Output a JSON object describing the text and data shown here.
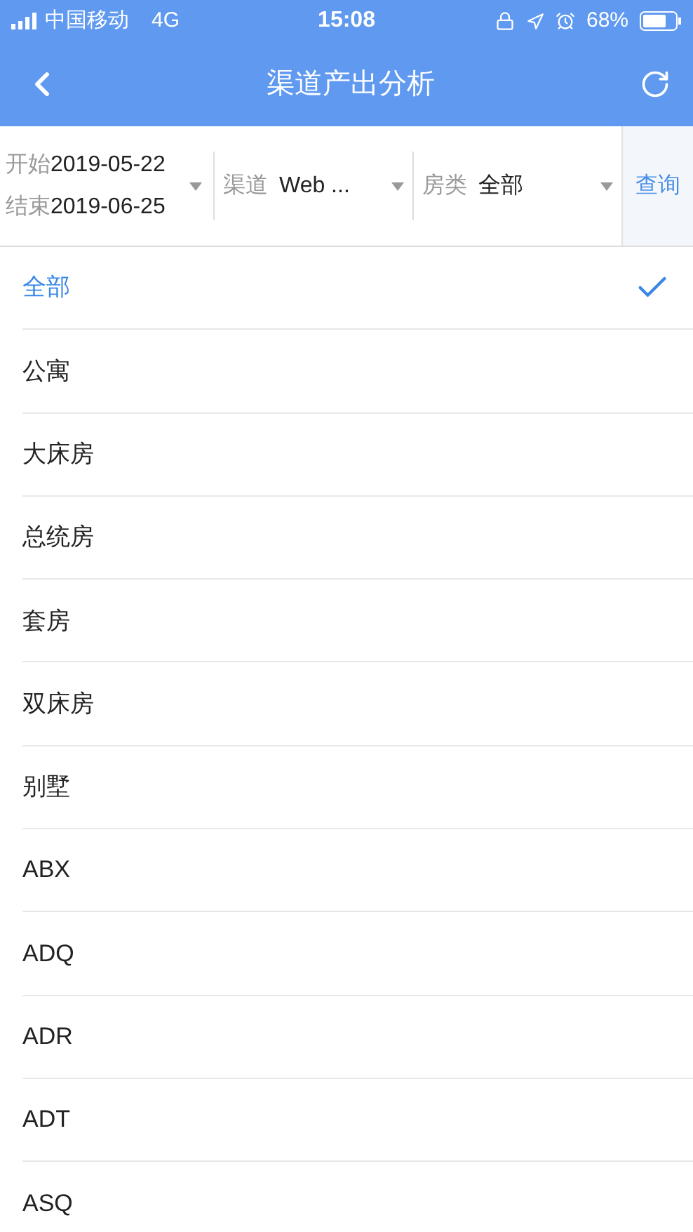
{
  "status_bar": {
    "carrier": "中国移动",
    "network": "4G",
    "time": "15:08",
    "battery": "68%"
  },
  "header": {
    "title": "渠道产出分析"
  },
  "filters": {
    "start_label": "开始",
    "start_date": "2019-05-22",
    "end_label": "结束",
    "end_date": "2019-06-25",
    "channel_label": "渠道",
    "channel_value": "Web ...",
    "room_label": "房类",
    "room_value": "全部",
    "query_button": "查询"
  },
  "options": [
    {
      "label": "全部",
      "selected": true
    },
    {
      "label": "公寓",
      "selected": false
    },
    {
      "label": "大床房",
      "selected": false
    },
    {
      "label": "总统房",
      "selected": false
    },
    {
      "label": "套房",
      "selected": false
    },
    {
      "label": "双床房",
      "selected": false
    },
    {
      "label": "别墅",
      "selected": false
    },
    {
      "label": "ABX",
      "selected": false
    },
    {
      "label": "ADQ",
      "selected": false
    },
    {
      "label": "ADR",
      "selected": false
    },
    {
      "label": "ADT",
      "selected": false
    },
    {
      "label": "ASQ",
      "selected": false
    }
  ]
}
